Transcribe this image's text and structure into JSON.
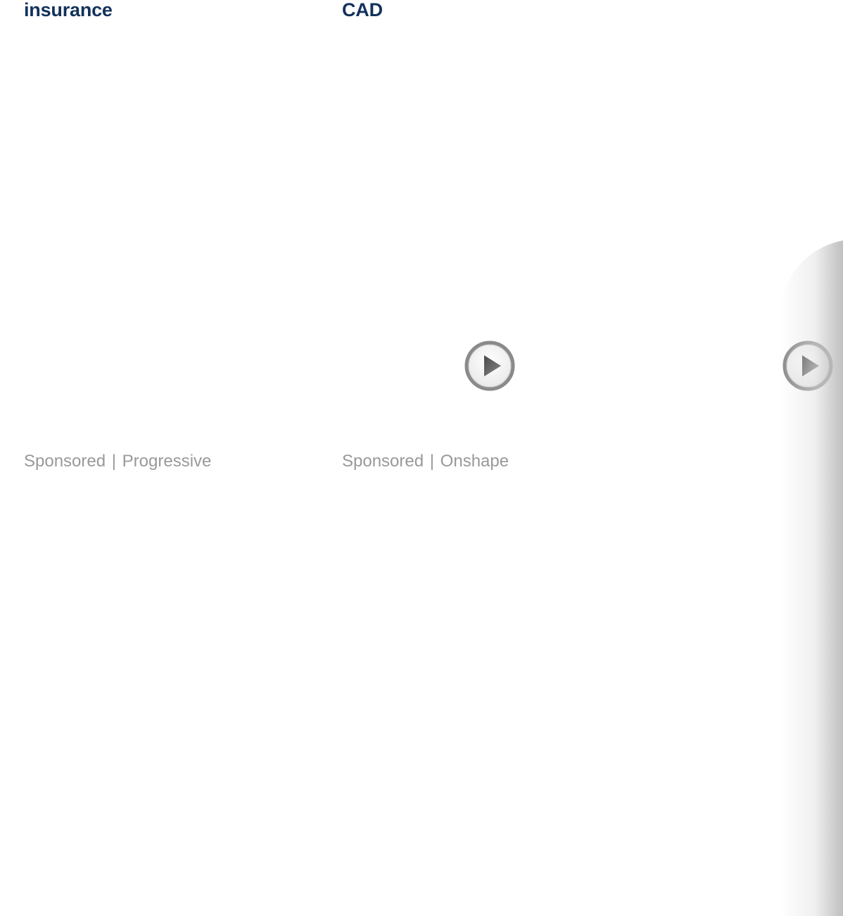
{
  "cards": [
    {
      "title": "insurance",
      "sponsored_label": "Sponsored",
      "separator": "|",
      "advertiser": "Progressive"
    },
    {
      "title": "CAD",
      "sponsored_label": "Sponsored",
      "separator": "|",
      "advertiser": "Onshape"
    }
  ],
  "icons": {
    "play": "play-icon"
  },
  "colors": {
    "title": "#13325b",
    "sponsor_text": "#999999",
    "play_ring": "#8a8a8a",
    "play_triangle": "#606060"
  }
}
